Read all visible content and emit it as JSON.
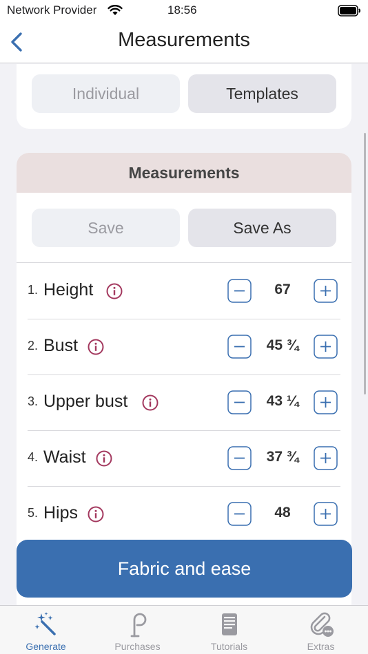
{
  "status": {
    "carrier": "Network Provider",
    "time": "18:56"
  },
  "nav": {
    "title": "Measurements"
  },
  "mode_selector": {
    "left": "Individual",
    "right": "Templates"
  },
  "measurements_card": {
    "header": "Measurements",
    "save_label": "Save",
    "save_as_label": "Save As"
  },
  "rows": [
    {
      "num": "1.",
      "label": "Height",
      "value": "67"
    },
    {
      "num": "2.",
      "label": "Bust",
      "value": "45 ¾"
    },
    {
      "num": "3.",
      "label": "Upper bust",
      "value": "43 ¼"
    },
    {
      "num": "4.",
      "label": "Waist",
      "value": "37 ¾"
    },
    {
      "num": "5.",
      "label": "Hips",
      "value": "48"
    }
  ],
  "cta": {
    "label": "Fabric and ease"
  },
  "tabs": [
    {
      "label": "Generate",
      "icon": "magic-wand-icon",
      "active": true
    },
    {
      "label": "Purchases",
      "icon": "pattern-hook-icon",
      "active": false
    },
    {
      "label": "Tutorials",
      "icon": "book-icon",
      "active": false
    },
    {
      "label": "Extras",
      "icon": "paperclip-more-icon",
      "active": false
    }
  ],
  "colors": {
    "accent": "#3a6fb0",
    "info_icon": "#a3385e",
    "header_bg": "#eadfdf"
  }
}
